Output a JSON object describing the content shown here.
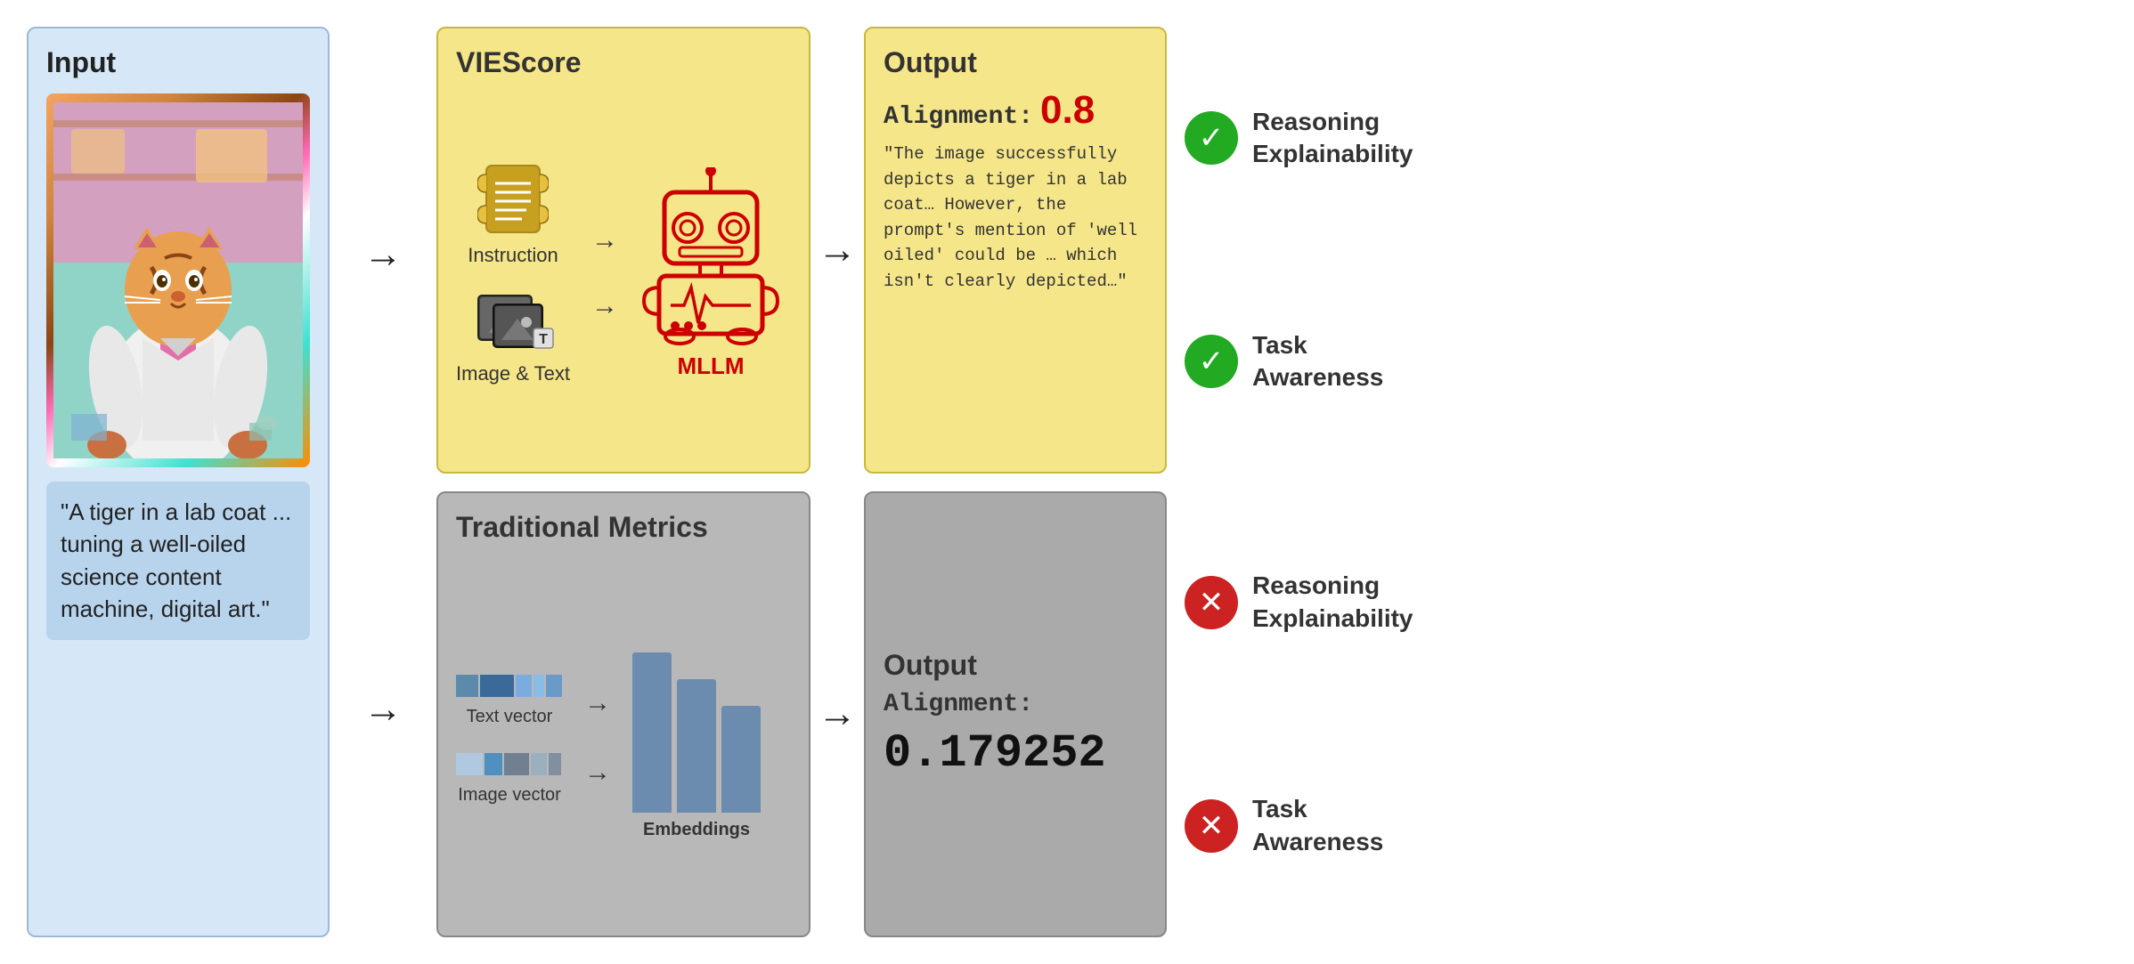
{
  "input": {
    "title": "Input",
    "caption": "\"A tiger in a lab coat ... tuning a well-oiled science content machine, digital art.\""
  },
  "viescore": {
    "title": "VIEScore",
    "instruction_label": "Instruction",
    "image_text_label": "Image & Text",
    "mllm_label": "MLLM"
  },
  "output_viescore": {
    "title": "Output",
    "alignment_label": "Alignment:",
    "alignment_value": "0.8",
    "output_text": "\"The image successfully\ndepicts a tiger in a lab\ncoat… However, the\nprompt's mention of\n'well oiled' could be …\nwhich isn't clearly\ndepicted…\""
  },
  "traditional": {
    "title": "Traditional Metrics",
    "text_vector_label": "Text vector",
    "image_vector_label": "Image vector",
    "embeddings_label": "Embeddings"
  },
  "output_traditional": {
    "title": "Output",
    "alignment_label": "Alignment:",
    "alignment_value": "0.179252"
  },
  "features": {
    "reasoning_explainability": "Reasoning\nExplainability",
    "task_awareness": "Task\nAwareness"
  },
  "arrows": {
    "right": "→"
  }
}
